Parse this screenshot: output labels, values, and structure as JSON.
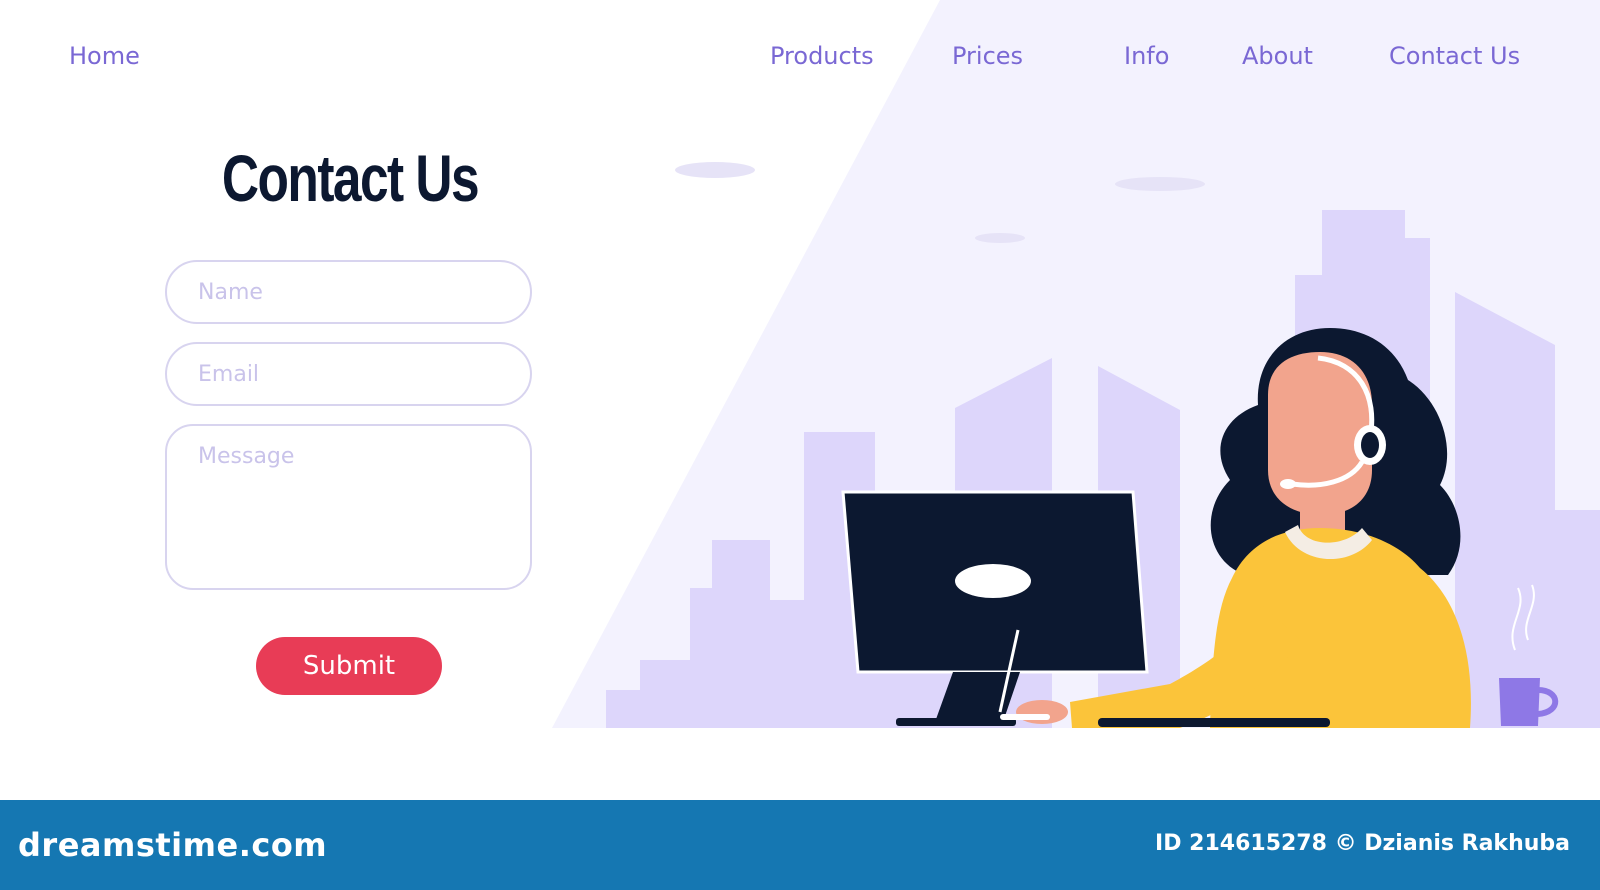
{
  "nav": {
    "home": "Home",
    "products": "Products",
    "prices": "Prices",
    "info": "Info",
    "about": "About",
    "contact": "Contact Us"
  },
  "form": {
    "title": "Contact Us",
    "name_placeholder": "Name",
    "email_placeholder": "Email",
    "message_placeholder": "Message",
    "submit_label": "Submit"
  },
  "footer": {
    "logo": "dreamstime.com",
    "credit": "ID 214615278 © Dzianis Rakhuba"
  },
  "colors": {
    "nav_link": "#7a68d4",
    "title": "#0c1830",
    "submit": "#e83c56",
    "field_border": "#d8d4ef",
    "background_panel": "#f3f2fe",
    "buildings": "#ddd6fb",
    "footer": "#1577b2",
    "shirt": "#fbc43a",
    "monitor": "#0c1830"
  },
  "illustration": {
    "subject": "woman-with-headset-at-computer",
    "icons": [
      "monitor-icon",
      "headset-icon",
      "mug-icon",
      "city-skyline"
    ]
  }
}
